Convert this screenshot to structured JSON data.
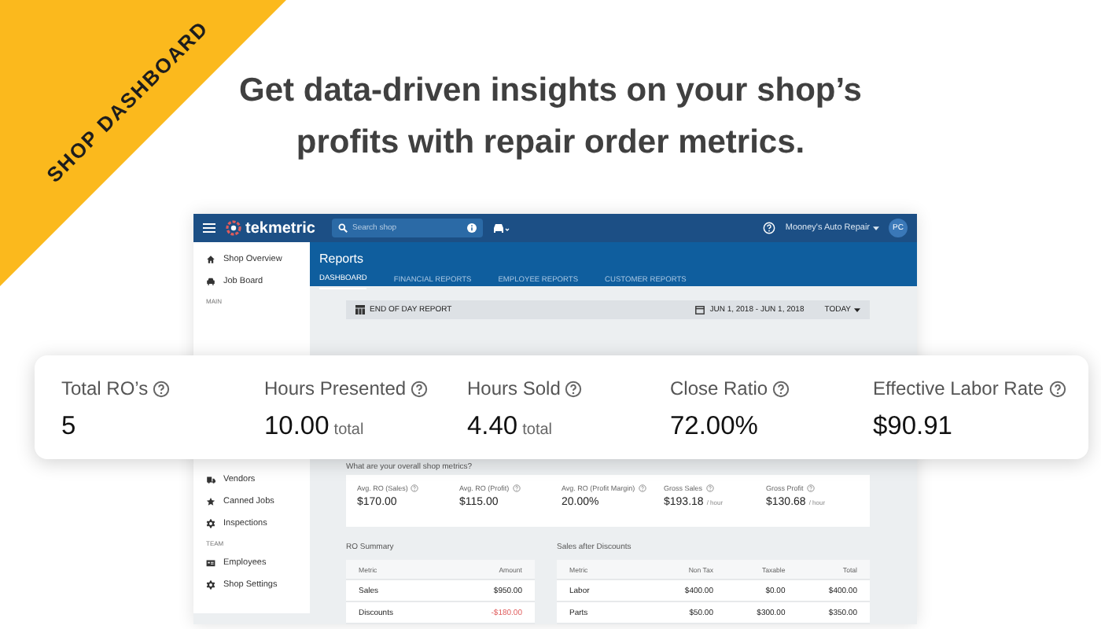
{
  "banner": {
    "label": "SHOP DASHBOARD"
  },
  "headline": [
    "Get data-driven insights on your shop’s",
    "profits with repair order metrics."
  ],
  "app": {
    "topbar": {
      "logo": "tekmetric",
      "search": {
        "placeholder": "Search shop"
      },
      "shop_name": "Mooney's Auto Repair",
      "avatar": "PC"
    },
    "sidebar": [
      {
        "kind": "item",
        "label": "Shop Overview"
      },
      {
        "kind": "item",
        "label": "Job Board"
      },
      {
        "kind": "section",
        "label": "MAIN"
      },
      {
        "kind": "gap"
      },
      {
        "kind": "item",
        "label": "Vendors"
      },
      {
        "kind": "item",
        "label": "Canned Jobs"
      },
      {
        "kind": "item",
        "label": "Inspections"
      },
      {
        "kind": "section",
        "label": "TEAM"
      },
      {
        "kind": "item",
        "label": "Employees"
      },
      {
        "kind": "item",
        "label": "Shop Settings"
      }
    ],
    "page_title": "Reports",
    "tabs": [
      {
        "label": "DASHBOARD",
        "selected": true
      },
      {
        "label": "FINANCIAL REPORTS",
        "selected": false
      },
      {
        "label": "EMPLOYEE REPORTS",
        "selected": false
      },
      {
        "label": "CUSTOMER REPORTS",
        "selected": false
      }
    ],
    "report_bar": {
      "title": "END OF DAY REPORT",
      "date_range": "JUN 1, 2018 - JUN 1, 2018",
      "period": "TODAY"
    },
    "prompt": "What are your overall shop metrics?",
    "metrics": [
      {
        "label": "Avg. RO (Sales)",
        "value": "$170.00"
      },
      {
        "label": "Avg. RO (Profit)",
        "value": "$115.00"
      },
      {
        "label": "Avg. RO (Profit Margin)",
        "value": "20.00%"
      },
      {
        "label": "Gross Sales",
        "value": "$193.18",
        "unit": "/ hour"
      },
      {
        "label": "Gross Profit",
        "value": "$130.68",
        "unit": "/ hour"
      }
    ],
    "ro_summary": {
      "title": "RO Summary",
      "columns": [
        "Metric",
        "Amount"
      ],
      "rows": [
        {
          "cells": [
            "Sales",
            "$950.00"
          ],
          "negative": false
        },
        {
          "cells": [
            "Discounts",
            "-$180.00"
          ],
          "negative": true
        }
      ]
    },
    "sales_after_discounts": {
      "title": "Sales after Discounts",
      "columns": [
        "Metric",
        "Non Tax",
        "Taxable",
        "Total"
      ],
      "rows": [
        {
          "cells": [
            "Labor",
            "$400.00",
            "$0.00",
            "$400.00"
          ],
          "negative": false
        },
        {
          "cells": [
            "Parts",
            "$50.00",
            "$300.00",
            "$350.00"
          ],
          "negative": false
        }
      ]
    }
  },
  "kpis": [
    {
      "label": "Total RO’s",
      "value": "5"
    },
    {
      "label": "Hours Presented",
      "value": "10.00",
      "unit": "total"
    },
    {
      "label": "Hours Sold",
      "value": "4.40",
      "unit": "total"
    },
    {
      "label": "Close Ratio",
      "value": "72.00%"
    },
    {
      "label": "Effective Labor Rate",
      "value": "$90.91"
    }
  ]
}
